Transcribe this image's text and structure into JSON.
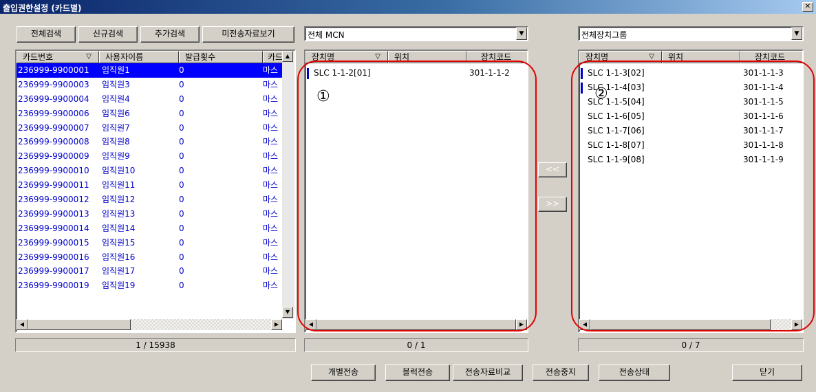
{
  "window": {
    "title": "출입권한설정 (카드별)",
    "close_glyph": "✕"
  },
  "toolbar": {
    "search_all": "전체검색",
    "search_new": "신규검색",
    "search_add": "추가검색",
    "view_unsent": "미전송자료보기"
  },
  "mcn_select": {
    "value": "전체 MCN"
  },
  "group_select": {
    "value": "전체장치그룹"
  },
  "card_table": {
    "columns": [
      "카드번호",
      "사용자이름",
      "발급횟수",
      "카드"
    ],
    "rows": [
      [
        "236999-9900001",
        "임직원1",
        "0",
        "마스"
      ],
      [
        "236999-9900003",
        "임직원3",
        "0",
        "마스"
      ],
      [
        "236999-9900004",
        "임직원4",
        "0",
        "마스"
      ],
      [
        "236999-9900006",
        "임직원6",
        "0",
        "마스"
      ],
      [
        "236999-9900007",
        "임직원7",
        "0",
        "마스"
      ],
      [
        "236999-9900008",
        "임직원8",
        "0",
        "마스"
      ],
      [
        "236999-9900009",
        "임직원9",
        "0",
        "마스"
      ],
      [
        "236999-9900010",
        "임직원10",
        "0",
        "마스"
      ],
      [
        "236999-9900011",
        "임직원11",
        "0",
        "마스"
      ],
      [
        "236999-9900012",
        "임직원12",
        "0",
        "마스"
      ],
      [
        "236999-9900013",
        "임직원13",
        "0",
        "마스"
      ],
      [
        "236999-9900014",
        "임직원14",
        "0",
        "마스"
      ],
      [
        "236999-9900015",
        "임직원15",
        "0",
        "마스"
      ],
      [
        "236999-9900016",
        "임직원16",
        "0",
        "마스"
      ],
      [
        "236999-9900017",
        "임직원17",
        "0",
        "마스"
      ],
      [
        "236999-9900019",
        "임직원19",
        "0",
        "마스"
      ]
    ],
    "selected_index": 0,
    "status": "1 / 15938"
  },
  "assigned_devices": {
    "columns": [
      "장치명",
      "위치",
      "장치코드"
    ],
    "rows": [
      {
        "name": "SLC 1-1-2[01]",
        "location": "",
        "code": "301-1-1-2",
        "marked": true
      }
    ],
    "status": "0 / 1",
    "annotation": "①"
  },
  "available_devices": {
    "columns": [
      "장치명",
      "위치",
      "장치코드"
    ],
    "rows": [
      {
        "name": "SLC 1-1-3[02]",
        "location": "",
        "code": "301-1-1-3",
        "marked": true
      },
      {
        "name": "SLC 1-1-4[03]",
        "location": "",
        "code": "301-1-1-4",
        "marked": true
      },
      {
        "name": "SLC 1-1-5[04]",
        "location": "",
        "code": "301-1-1-5",
        "marked": false
      },
      {
        "name": "SLC 1-1-6[05]",
        "location": "",
        "code": "301-1-1-6",
        "marked": false
      },
      {
        "name": "SLC 1-1-7[06]",
        "location": "",
        "code": "301-1-1-7",
        "marked": false
      },
      {
        "name": "SLC 1-1-8[07]",
        "location": "",
        "code": "301-1-1-8",
        "marked": false
      },
      {
        "name": "SLC 1-1-9[08]",
        "location": "",
        "code": "301-1-1-9",
        "marked": false
      }
    ],
    "status": "0 / 7",
    "annotation": "②"
  },
  "transfer": {
    "move_left": "<<",
    "move_right": ">>"
  },
  "bottom_buttons": {
    "individual_send": "개별전송",
    "block_send": "블럭전송",
    "compare_sent": "전송자료비교",
    "stop_send": "전송중지",
    "send_status": "전송상태",
    "close": "닫기"
  },
  "colors": {
    "annotation": "#e00000",
    "selection": "#0000ff",
    "link_text": "#0000cc"
  }
}
